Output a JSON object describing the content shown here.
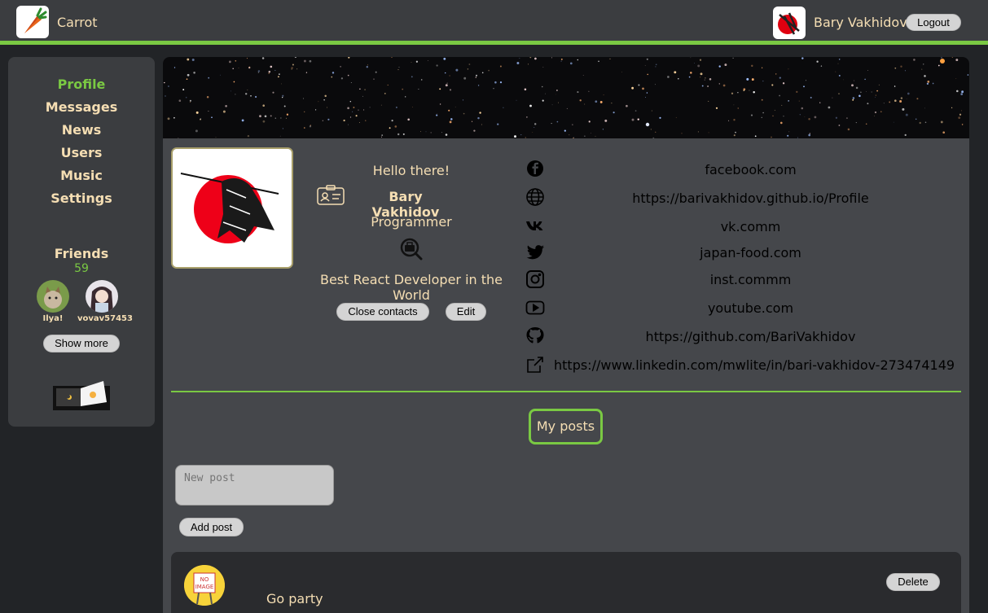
{
  "header": {
    "app_title": "Carrot",
    "user_name": "Bary Vakhidov",
    "logout_label": "Logout"
  },
  "sidebar": {
    "nav": [
      "Profile",
      "Messages",
      "News",
      "Users",
      "Music",
      "Settings"
    ],
    "active": "Profile",
    "friends_title": "Friends",
    "friends_count": "59",
    "friends": [
      {
        "name": "Ilya!"
      },
      {
        "name": "vovav57453"
      }
    ],
    "show_more_label": "Show more"
  },
  "profile": {
    "greeting": "Hello there!",
    "name": "Bary Vakhidov",
    "job": "Programmer",
    "status": "Best React Developer in the World",
    "close_contacts_label": "Close contacts",
    "edit_label": "Edit",
    "contacts": [
      {
        "icon": "facebook-icon",
        "value": "facebook.com"
      },
      {
        "icon": "website-icon",
        "value": "https://barivakhidov.github.io/Profile"
      },
      {
        "icon": "vk-icon",
        "value": "vk.comm"
      },
      {
        "icon": "twitter-icon",
        "value": "japan-food.com"
      },
      {
        "icon": "instagram-icon",
        "value": "inst.commm"
      },
      {
        "icon": "youtube-icon",
        "value": "youtube.com"
      },
      {
        "icon": "github-icon",
        "value": "https://github.com/BariVakhidov"
      },
      {
        "icon": "external-link-icon",
        "value": "https://www.linkedin.com/mwlite/in/bari-vakhidov-273474149"
      }
    ]
  },
  "posts": {
    "title": "My posts",
    "new_post_placeholder": "New post",
    "add_post_label": "Add post",
    "items": [
      {
        "text": "Go party",
        "delete_label": "Delete",
        "avatar_text": "NO IMAGE"
      }
    ]
  },
  "colors": {
    "accent": "#7ac943",
    "text": "#f5deb3",
    "header_bg": "#3b3d40",
    "panel_bg": "#45474b"
  }
}
